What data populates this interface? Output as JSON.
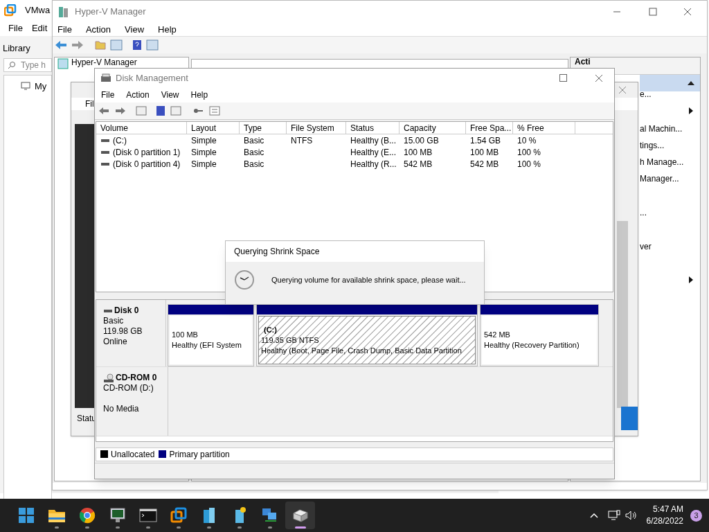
{
  "vmware": {
    "title": "VMwa",
    "menu": [
      "File",
      "Edit"
    ],
    "library": "Library",
    "search_placeholder": "Type h",
    "tree": [
      "My"
    ]
  },
  "hyperv": {
    "title": "Hyper-V Manager",
    "menu": [
      "File",
      "Action",
      "View",
      "Help"
    ],
    "tree": [
      "Hyper-V Manager"
    ],
    "actions": {
      "header": "Acti",
      "items": [
        {
          "label": "e...",
          "submenu": false
        },
        {
          "submenu": true
        },
        {
          "label": "al Machin...",
          "submenu": false
        },
        {
          "label": "tings...",
          "submenu": false
        },
        {
          "label": "h Manage...",
          "submenu": false
        },
        {
          "label": "Manager...",
          "submenu": false
        },
        {
          "label": "...",
          "submenu": false
        },
        {
          "label": "ver",
          "submenu": false
        },
        {
          "submenu": true
        }
      ]
    }
  },
  "computer_management": {
    "menu": [
      "Fil"
    ],
    "status": "Statu"
  },
  "disk_management": {
    "title": "Disk Management",
    "menu": [
      "File",
      "Action",
      "View",
      "Help"
    ],
    "table": {
      "columns": [
        "Volume",
        "Layout",
        "Type",
        "File System",
        "Status",
        "Capacity",
        "Free Spa...",
        "% Free"
      ],
      "rows": [
        [
          "(C:)",
          "Simple",
          "Basic",
          "NTFS",
          "Healthy (B...",
          "15.00 GB",
          "1.54 GB",
          "10 %"
        ],
        [
          "(Disk 0 partition 1)",
          "Simple",
          "Basic",
          "",
          "Healthy (E...",
          "100 MB",
          "100 MB",
          "100 %"
        ],
        [
          "(Disk 0 partition 4)",
          "Simple",
          "Basic",
          "",
          "Healthy (R...",
          "542 MB",
          "542 MB",
          "100 %"
        ]
      ]
    },
    "disks": [
      {
        "kind": "disk",
        "name": "Disk 0",
        "type": "Basic",
        "size": "119.98 GB",
        "status": "Online",
        "partitions": [
          {
            "size": "100 MB",
            "status": "Healthy (EFI System",
            "selected": false
          },
          {
            "label": "(C:)",
            "size": "119.35 GB NTFS",
            "status": "Healthy (Boot, Page File, Crash Dump, Basic Data Partition",
            "selected": true
          },
          {
            "size": "542 MB",
            "status": "Healthy (Recovery Partition)",
            "selected": false
          }
        ]
      },
      {
        "kind": "cdrom",
        "name": "CD-ROM 0",
        "type": "CD-ROM (D:)",
        "status": "No Media"
      }
    ],
    "legend": [
      {
        "label": "Unallocated",
        "color": "#000000"
      },
      {
        "label": "Primary partition",
        "color": "#000080"
      }
    ]
  },
  "dialog": {
    "title": "Querying Shrink Space",
    "message": "Querying volume for available shrink space, please wait..."
  },
  "taskbar": {
    "apps": [
      {
        "kind": "start",
        "running": false,
        "selected": false
      },
      {
        "kind": "folder",
        "running": true,
        "selected": false
      },
      {
        "kind": "browser",
        "running": true,
        "selected": false
      },
      {
        "kind": "monitor",
        "running": true,
        "selected": false
      },
      {
        "kind": "terminal",
        "running": true,
        "selected": false
      },
      {
        "kind": "vmware",
        "running": true,
        "selected": false
      },
      {
        "kind": "server",
        "running": true,
        "selected": false
      },
      {
        "kind": "server2",
        "running": true,
        "selected": false
      },
      {
        "kind": "network",
        "running": true,
        "selected": false
      },
      {
        "kind": "disk",
        "running": true,
        "selected": true
      }
    ],
    "time": "5:47 AM",
    "date": "6/28/2022",
    "badge": "3"
  }
}
